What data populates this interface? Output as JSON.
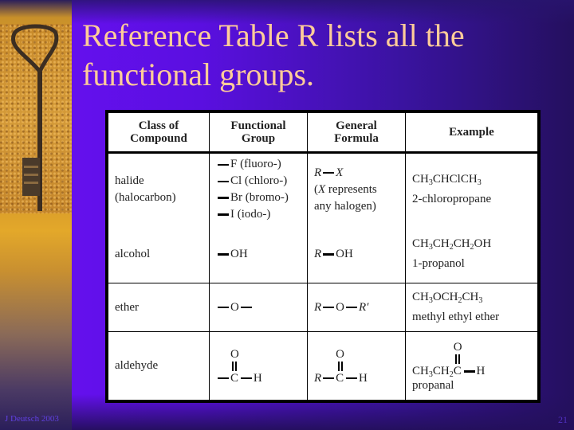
{
  "slide": {
    "title_line1": "Reference Table R lists all the",
    "title_line2": "functional groups.",
    "footer_author": "J Deutsch 2003",
    "page_number": "21",
    "colors": {
      "title": "#ffcc99",
      "background_accent": "#6a10f5"
    }
  },
  "table": {
    "headers": {
      "class": [
        "Class of",
        "Compound"
      ],
      "group": [
        "Functional",
        "Group"
      ],
      "formula": [
        "General",
        "Formula"
      ],
      "example": "Example"
    },
    "halide": {
      "class_line1": "halide",
      "class_line2": "(halocarbon)",
      "groups": [
        "F (fluoro-)",
        "Cl (chloro-)",
        "Br (bromo-)",
        "I (iodo-)"
      ],
      "formula_r": "R",
      "formula_x": "X",
      "formula_note1_pre": "(",
      "formula_note1_x": "X",
      "formula_note1_post": " represents",
      "formula_note2": "any halogen)",
      "example_parts": [
        "CH",
        "3",
        "CHClCH",
        "3"
      ],
      "example_name": "2-chloropropane"
    },
    "alcohol": {
      "class": "alcohol",
      "group": "OH",
      "formula_r": "R",
      "formula_rest": "OH",
      "example_parts": [
        "CH",
        "3",
        "CH",
        "2",
        "CH",
        "2",
        "OH"
      ],
      "example_name": "1-propanol"
    },
    "ether": {
      "class": "ether",
      "group": "O",
      "formula_r": "R",
      "formula_o": "O",
      "formula_r2": "R′",
      "example_parts": [
        "CH",
        "3",
        "OCH",
        "2",
        "CH",
        "3"
      ],
      "example_name": "methyl ethyl ether"
    },
    "aldehyde": {
      "class": "aldehyde",
      "group_o": "O",
      "group_c": "C",
      "group_h": "H",
      "formula_r": "R",
      "formula_o": "O",
      "formula_c": "C",
      "formula_h": "H",
      "example_parts": [
        "CH",
        "3",
        "CH",
        "2"
      ],
      "example_o": "O",
      "example_c": "C",
      "example_h": "H",
      "example_name": "propanal"
    }
  }
}
